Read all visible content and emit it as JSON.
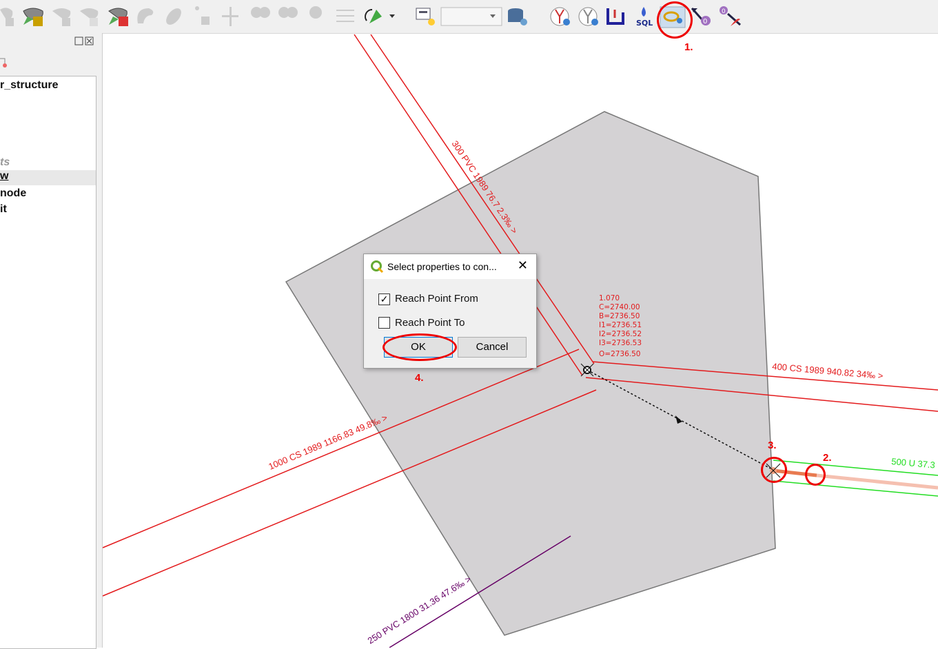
{
  "toolbar": {
    "icons": [
      "delete-part-icon",
      "add-ring-icon",
      "fill-ring-icon",
      "delete-ring-icon",
      "delete-part-red-icon",
      "reshape-icon",
      "offset-icon",
      "simplify-icon",
      "vertex-tool-icon",
      "split-features-icon",
      "split-parts-icon",
      "merge-icon",
      "align-icon",
      "rotate-point-icon",
      "dropdown-arrow-icon",
      "layer-config-icon",
      "combo-box",
      "database-icon",
      "upstream-icon",
      "downstream-icon",
      "profile-icon",
      "sql-icon",
      "connect-network-elements-icon",
      "node-flag-icon",
      "reach-flag-icon"
    ],
    "combo_value": ""
  },
  "panel": {
    "items": [
      "r_structure",
      "ts",
      "w",
      "node",
      "it"
    ]
  },
  "map": {
    "labels": {
      "pipe_300": "300 PVC 1989 76.7 2.3‰ >",
      "pipe_400": "400 CS 1989 940.82 34‰ >",
      "pipe_1000": "1000 CS 1989 1166.83 49.8‰ >",
      "pipe_250": "250 PVC 1800 31.36 47.6‰ >",
      "pipe_500": "500 U 37.3"
    },
    "node_info": [
      "1.070",
      "C=2740.00",
      "B=2736.50",
      "I1=2736.51",
      "I2=2736.52",
      "I3=2736.53",
      "O=2736.50"
    ],
    "colors": {
      "pipe": "#e31a1c",
      "green": "#22dd22",
      "purple": "#660066",
      "polygon": "#d4d2d4",
      "annotation": "#e00000"
    }
  },
  "dialog": {
    "title": "Select properties to con...",
    "options": [
      {
        "label": "Reach Point From",
        "checked": true
      },
      {
        "label": "Reach Point To",
        "checked": false
      }
    ],
    "ok": "OK",
    "cancel": "Cancel"
  },
  "annotations": [
    "1.",
    "2.",
    "3.",
    "4."
  ]
}
